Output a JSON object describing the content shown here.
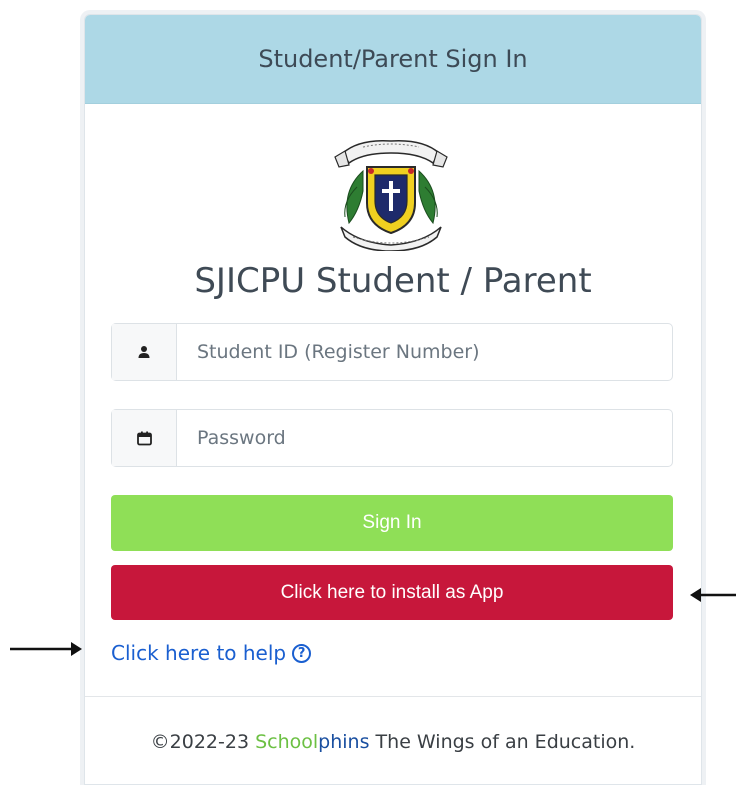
{
  "header": {
    "title": "Student/Parent Sign In"
  },
  "logo": {
    "name": "school-crest"
  },
  "brand": {
    "title": "SJICPU Student / Parent"
  },
  "form": {
    "student_id": {
      "placeholder": "Student ID (Register Number)",
      "value": "",
      "icon": "user-icon"
    },
    "password": {
      "placeholder": "Password",
      "value": "",
      "icon": "calendar-icon"
    },
    "signin_label": "Sign In",
    "install_label": "Click here to install as App"
  },
  "help": {
    "label": "Click here to help",
    "icon": "question-circle-icon"
  },
  "footer": {
    "prefix": "©2022-23 ",
    "brand_school": "School",
    "brand_phins": "phins",
    "suffix": " The Wings of an Education."
  },
  "colors": {
    "header_bg": "#add8e6",
    "signin_bg": "#8fdf57",
    "install_bg": "#c7173b",
    "link": "#1a5fd0",
    "brand_green": "#6cc043",
    "brand_blue": "#1a4fa0"
  }
}
